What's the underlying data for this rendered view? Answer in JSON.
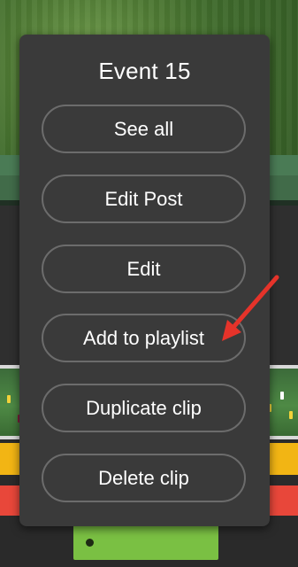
{
  "menu": {
    "title": "Event 15",
    "buttons": [
      {
        "label": "See all"
      },
      {
        "label": "Edit Post"
      },
      {
        "label": "Edit"
      },
      {
        "label": "Add to playlist"
      },
      {
        "label": "Duplicate clip"
      },
      {
        "label": "Delete clip"
      }
    ]
  },
  "annotation": {
    "arrow_color": "#e5332a",
    "icon": "arrow-pointer-icon"
  },
  "colors": {
    "menu_bg": "#3a3a3a",
    "button_border": "#6c6c6c",
    "yellow_band": "#f2b514",
    "red_band": "#e8473a",
    "green_button": "#7ac043"
  }
}
